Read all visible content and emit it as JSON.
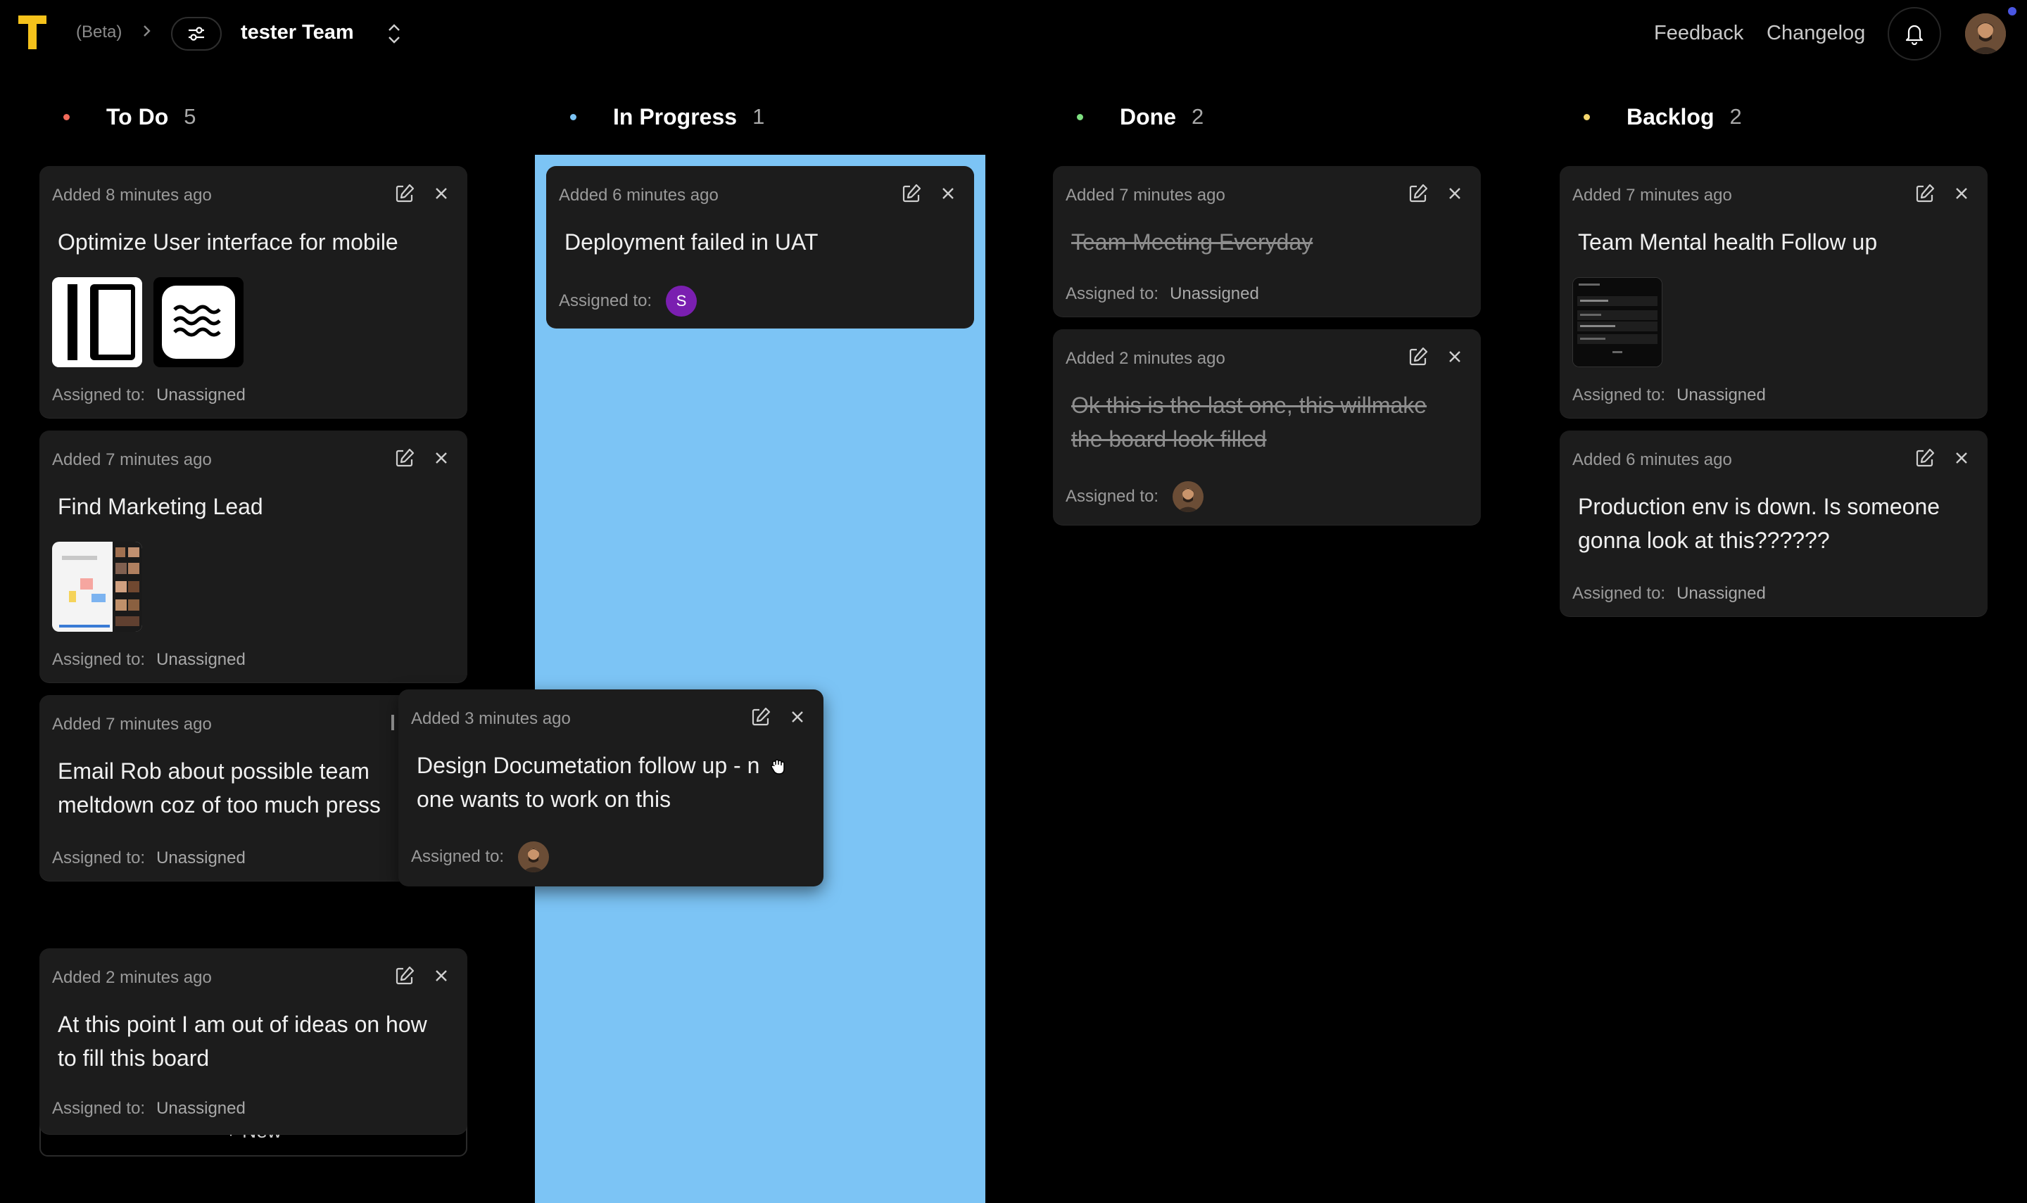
{
  "header": {
    "beta_label": "(Beta)",
    "team_name": "tester Team",
    "nav": {
      "feedback": "Feedback",
      "changelog": "Changelog"
    }
  },
  "colors": {
    "background": "#000000",
    "card": "#1c1c1c",
    "drop_highlight": "#7cc4f5",
    "logo_yellow": "#f5c21b",
    "todo_dot": "#f26b5b",
    "in_progress_dot": "#7cc4f5",
    "done_dot": "#7ee081",
    "backlog_dot": "#f5d76e",
    "assignee_s": "#7a1fb0"
  },
  "columns": [
    {
      "title": "To Do",
      "count": "5"
    },
    {
      "title": "In Progress",
      "count": "1"
    },
    {
      "title": "Done",
      "count": "2"
    },
    {
      "title": "Backlog",
      "count": "2"
    }
  ],
  "assigned_label": "Assigned to:",
  "unassigned": "Unassigned",
  "cards": {
    "todo_1": {
      "added": "Added 8 minutes ago",
      "title": "Optimize User interface for mobile",
      "assignee": "Unassigned"
    },
    "todo_2": {
      "added": "Added 7 minutes ago",
      "title": "Find Marketing Lead",
      "assignee": "Unassigned"
    },
    "todo_3": {
      "added": "Added 7 minutes ago",
      "title_line1": "Email Rob about possible team",
      "title_line2": "meltdown coz of too much press",
      "assignee": "Unassigned"
    },
    "todo_4": {
      "added": "Added 2 minutes ago",
      "title_line1": "At this point I am out of ideas on how",
      "title_line2": "to fill this board",
      "assignee": "Unassigned"
    },
    "progress_1": {
      "added": "Added 6 minutes ago",
      "title": "Deployment failed in UAT",
      "assignee_initial": "S"
    },
    "done_1": {
      "added": "Added 7 minutes ago",
      "title": "Team Meeting Everyday",
      "assignee": "Unassigned"
    },
    "done_2": {
      "added": "Added 2 minutes ago",
      "title_line1": "Ok this is the last one, this willmake",
      "title_line2": "the board look filled"
    },
    "backlog_1": {
      "added": "Added 7 minutes ago",
      "title": "Team Mental health Follow up",
      "assignee": "Unassigned"
    },
    "backlog_2": {
      "added": "Added 6 minutes ago",
      "title_line1": "Production env is down. Is someone",
      "title_line2": "gonna look at this??????",
      "assignee": "Unassigned"
    },
    "dragging": {
      "added": "Added 3 minutes ago",
      "title_line1": "Design Documetation follow up - n",
      "title_line2": "one wants to work on this"
    }
  },
  "add_new_label": "+ New"
}
